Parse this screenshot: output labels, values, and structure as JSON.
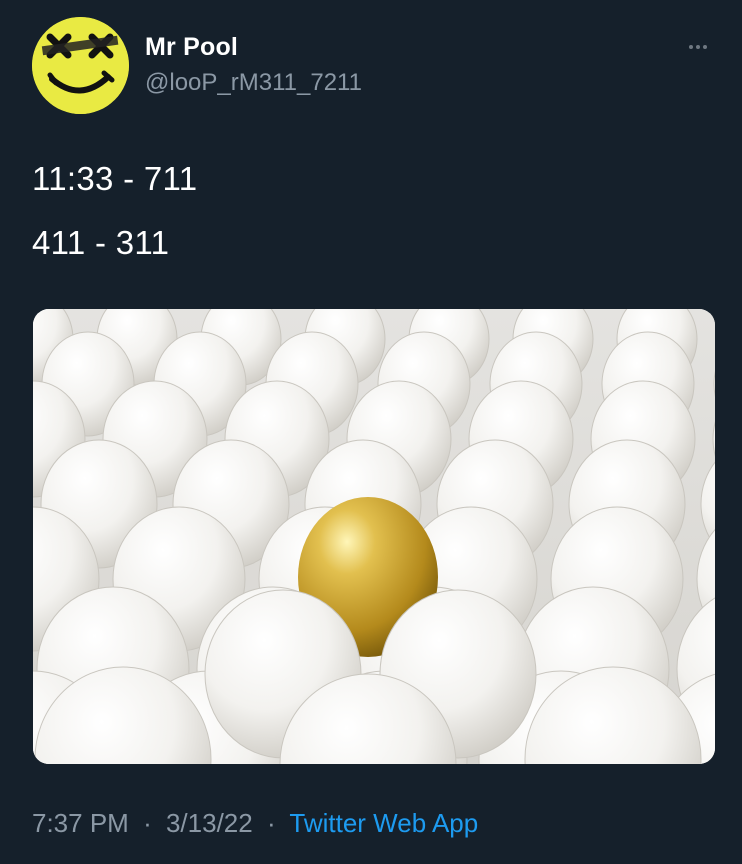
{
  "user": {
    "name": "Mr Pool",
    "handle": "@looP_rM311_7211"
  },
  "tweet": {
    "lines": [
      "11:33 - 711",
      "411 - 311"
    ]
  },
  "media": {
    "image_icon": "eggs-with-golden-egg-image",
    "colors": {
      "white_egg": "#f2f1ee",
      "golden_egg": "#c9a42e"
    }
  },
  "meta": {
    "time": "7:37 PM",
    "date": "3/13/22",
    "separator": "·",
    "source": "Twitter Web App"
  },
  "colors": {
    "background": "#15202b",
    "secondary_text": "#8b98a5",
    "link": "#1d9bf0",
    "avatar_yellow": "#e9ea43"
  }
}
